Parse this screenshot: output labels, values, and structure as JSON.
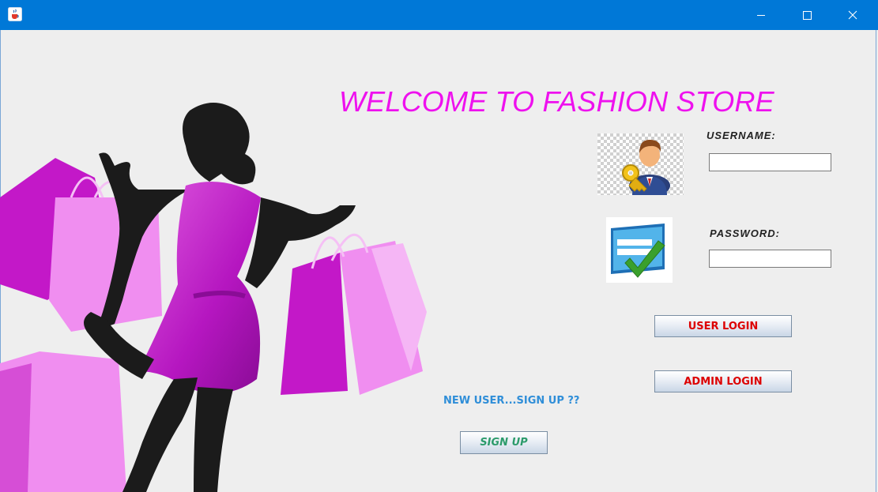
{
  "window": {
    "icon": "java-cup-icon",
    "controls": [
      "minimize-icon",
      "maximize-icon",
      "close-icon"
    ],
    "titlebar_color": "#0078d7"
  },
  "main": {
    "welcome": "WELCOME TO FASHION STORE",
    "username_label": "USERNAME:",
    "password_label": "PASSWORD:",
    "username_value": "",
    "password_value": "",
    "user_login": "USER LOGIN",
    "admin_login": "ADMIN LOGIN",
    "new_user": "NEW USER...SIGN UP ??",
    "sign_up": "SIGN UP"
  },
  "colors": {
    "welcome": "#ee11ee",
    "login_text": "#dd0000",
    "signup_text": "#2c9b6b",
    "new_user_text": "#2f8ed8",
    "bag_magenta": "#c814c8",
    "bag_pink": "#f08ef0"
  },
  "images": [
    "shopping-woman-illustration",
    "user-key-icon",
    "password-check-icon"
  ]
}
